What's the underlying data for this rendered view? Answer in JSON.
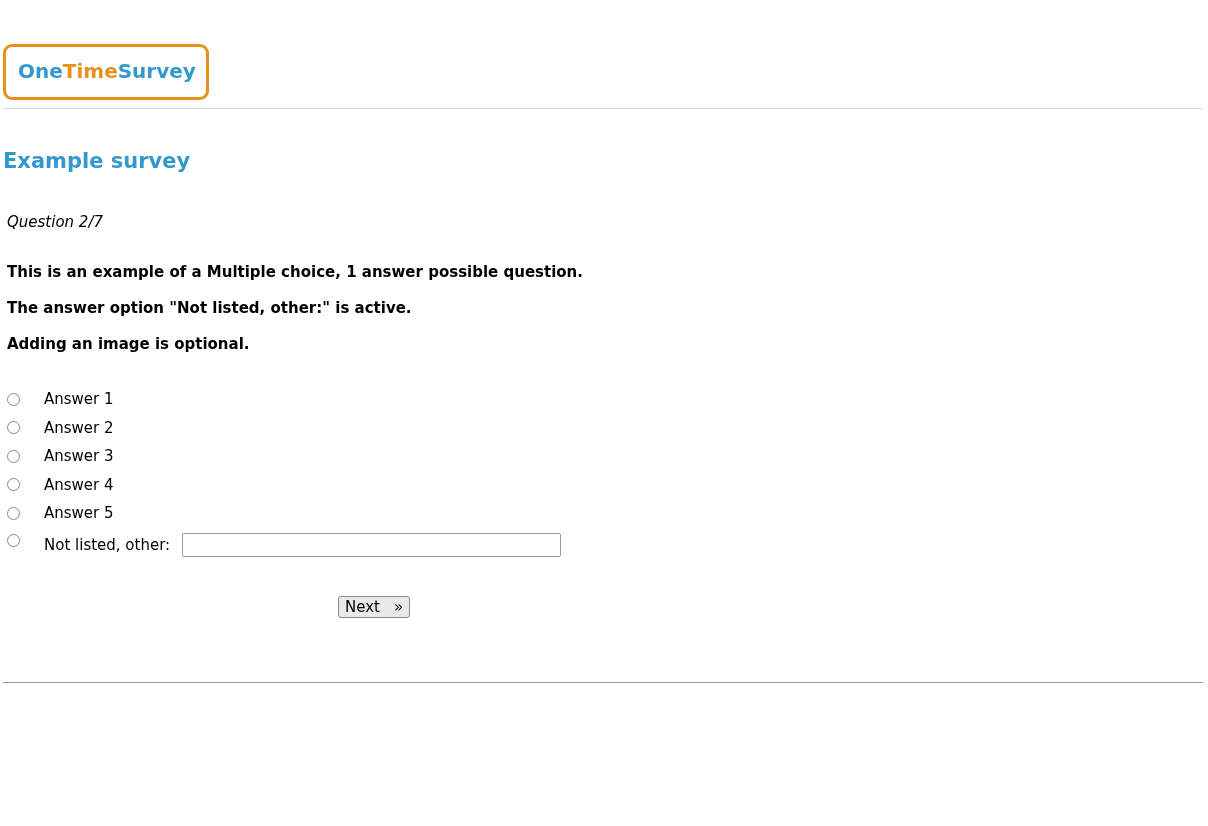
{
  "logo": [
    {
      "text": "One",
      "color": "#3399cc"
    },
    {
      "text": "Time",
      "color": "#e8901c"
    },
    {
      "text": "Survey",
      "color": "#3399cc"
    }
  ],
  "title": "Example survey",
  "progress": "Question 2/7",
  "question": [
    "This is an example of a Multiple choice, 1 answer possible question.",
    "The answer option \"Not listed, other:\" is active.",
    "Adding an image is optional."
  ],
  "options": [
    {
      "kind": "plain",
      "label": "Answer 1",
      "selected": false
    },
    {
      "kind": "plain",
      "label": "Answer 2",
      "selected": false
    },
    {
      "kind": "plain",
      "label": "Answer 3",
      "selected": false
    },
    {
      "kind": "plain",
      "label": "Answer 4",
      "selected": false
    },
    {
      "kind": "plain",
      "label": "Answer 5",
      "selected": false
    },
    {
      "kind": "other",
      "label": "Not listed, other:",
      "selected": false
    }
  ],
  "next_button": {
    "label": "Next",
    "arrow": "»"
  }
}
